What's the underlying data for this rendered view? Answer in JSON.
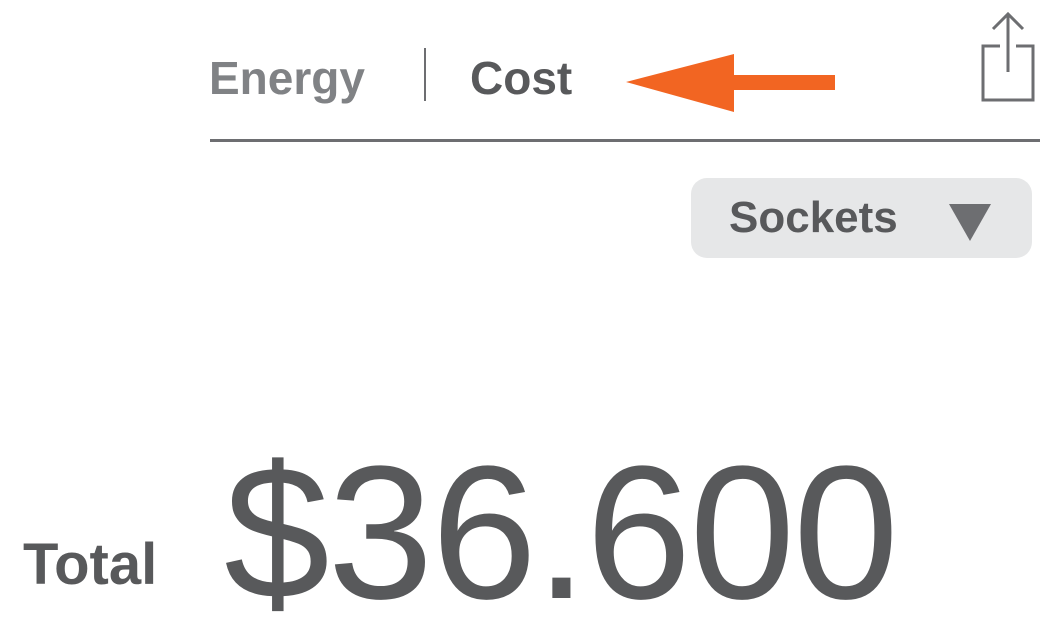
{
  "tabs": {
    "energy_label": "Energy",
    "cost_label": "Cost",
    "selected": "Cost"
  },
  "filter": {
    "selected": "Sockets"
  },
  "summary": {
    "label": "Total",
    "value": "$36.600"
  },
  "icons": {
    "share": "share-icon",
    "annotation_arrow": "arrow-left-icon",
    "caret": "caret-down-icon"
  },
  "colors": {
    "accent_arrow": "#f26522",
    "text_dark": "#58595b",
    "text_muted": "#808285",
    "dropdown_bg": "#e6e7e8"
  }
}
